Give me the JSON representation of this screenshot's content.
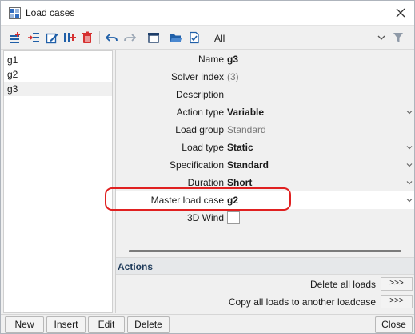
{
  "window": {
    "title": "Load cases"
  },
  "toolbar": {
    "filter_value": "All",
    "icons": [
      "new-record-icon",
      "insert-record-icon",
      "edit-record-icon",
      "add-before-icon",
      "delete-record-icon",
      "undo-icon",
      "redo-icon",
      "archive-icon",
      "open-folder-icon",
      "check-document-icon",
      "filter-icon"
    ]
  },
  "list": {
    "items": [
      {
        "label": "g1",
        "selected": false
      },
      {
        "label": "g2",
        "selected": false
      },
      {
        "label": "g3",
        "selected": true
      }
    ]
  },
  "properties": {
    "name": {
      "label": "Name",
      "value": "g3"
    },
    "solver_index": {
      "label": "Solver index",
      "value": "(3)"
    },
    "description": {
      "label": "Description",
      "value": ""
    },
    "action_type": {
      "label": "Action type",
      "value": "Variable"
    },
    "load_group": {
      "label": "Load group",
      "value": "Standard"
    },
    "load_type": {
      "label": "Load type",
      "value": "Static"
    },
    "specification": {
      "label": "Specification",
      "value": "Standard"
    },
    "duration": {
      "label": "Duration",
      "value": "Short"
    },
    "master": {
      "label": "Master load case",
      "value": "g2"
    },
    "wind3d": {
      "label": "3D Wind",
      "checked": false
    }
  },
  "actions": {
    "title": "Actions",
    "delete_all": {
      "label": "Delete all loads",
      "button": ">>>"
    },
    "copy_all": {
      "label": "Copy all loads to another loadcase",
      "button": ">>>"
    }
  },
  "footer": {
    "new": "New",
    "insert": "Insert",
    "edit": "Edit",
    "delete": "Delete",
    "close": "Close"
  },
  "colors": {
    "highlight": "#e02020",
    "actions_title": "#1e3a5a",
    "delete_red": "#d63030",
    "accent_blue": "#1f5fa8"
  }
}
